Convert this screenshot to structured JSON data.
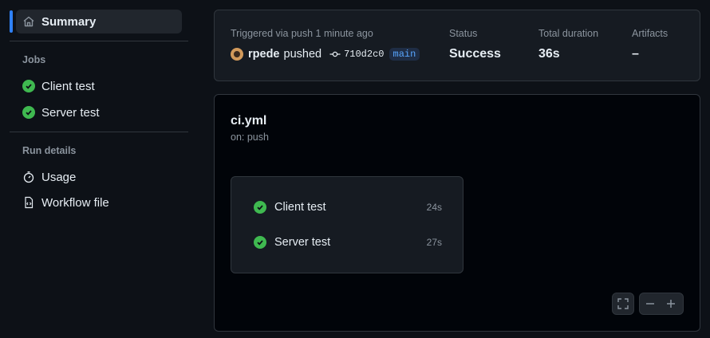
{
  "sidebar": {
    "summary_label": "Summary",
    "jobs_heading": "Jobs",
    "jobs": [
      {
        "label": "Client test",
        "status": "success"
      },
      {
        "label": "Server test",
        "status": "success"
      }
    ],
    "run_details_heading": "Run details",
    "usage_label": "Usage",
    "workflow_file_label": "Workflow file"
  },
  "summary": {
    "trigger_text": "Triggered via push 1 minute ago",
    "actor": "rpede",
    "action": "pushed",
    "commit": "710d2c0",
    "branch": "main",
    "status_label": "Status",
    "status_value": "Success",
    "duration_label": "Total duration",
    "duration_value": "36s",
    "artifacts_label": "Artifacts",
    "artifacts_value": "–"
  },
  "workflow": {
    "name": "ci.yml",
    "trigger": "on: push",
    "jobs": [
      {
        "label": "Client test",
        "duration": "24s"
      },
      {
        "label": "Server test",
        "duration": "27s"
      }
    ]
  },
  "colors": {
    "accent": "#2f81f7",
    "success": "#3fb950",
    "background": "#0d1117"
  },
  "icons": [
    "home-icon",
    "check-circle-icon",
    "stopwatch-icon",
    "file-code-icon",
    "git-commit-icon",
    "fullscreen-icon",
    "zoom-out-icon",
    "zoom-in-icon"
  ]
}
